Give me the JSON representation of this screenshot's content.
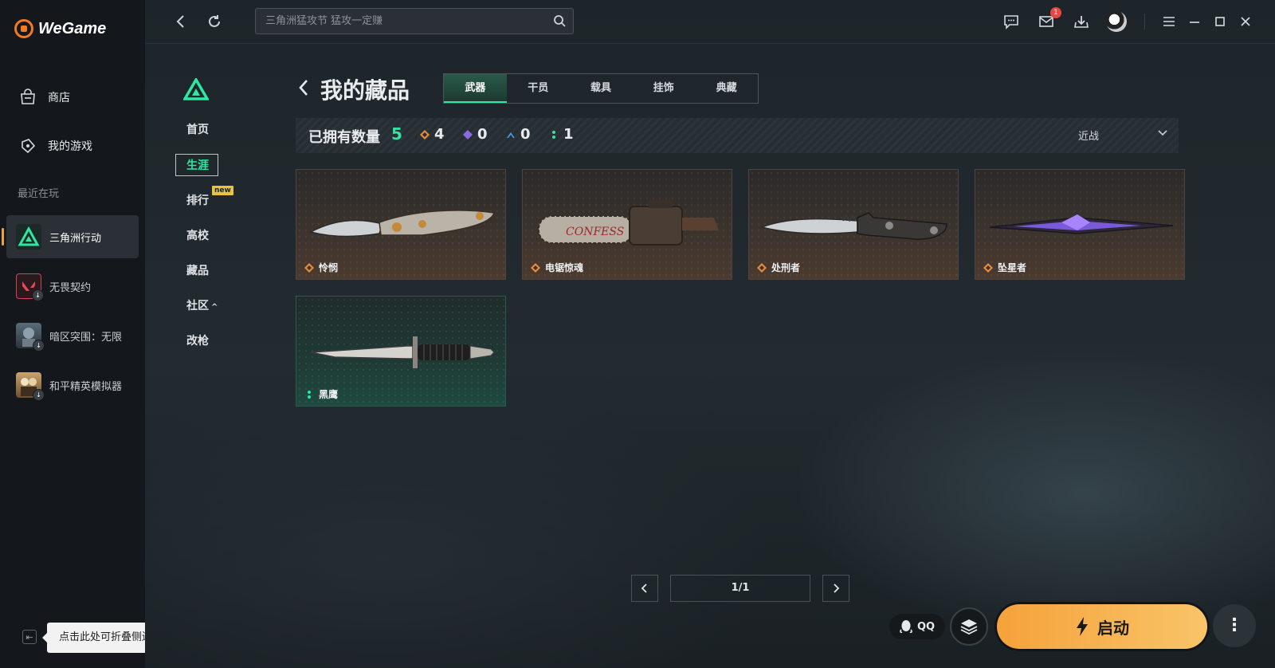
{
  "app": {
    "brand": "WeGame",
    "nav": [
      {
        "label": "商店",
        "icon": "store-icon"
      },
      {
        "label": "我的游戏",
        "icon": "gamepad-icon"
      }
    ],
    "recent_label": "最近在玩",
    "recent_games": [
      {
        "label": "三角洲行动",
        "active": true
      },
      {
        "label": "无畏契约",
        "active": false
      },
      {
        "label": "暗区突围：无限",
        "active": false
      },
      {
        "label": "和平精英模拟器",
        "active": false
      }
    ],
    "collapse_tooltip": "点击此处可折叠侧边栏"
  },
  "topbar": {
    "search_placeholder": "三角洲猛攻节  猛攻一定赚",
    "mail_badge": "1"
  },
  "game_nav": {
    "items": [
      "首页",
      "生涯",
      "排行",
      "高校",
      "藏品",
      "社区",
      "改枪"
    ],
    "active": "生涯",
    "new_badge": "new",
    "community_caret": "^"
  },
  "collection": {
    "title": "我的藏品",
    "tabs": [
      "武器",
      "干员",
      "载具",
      "挂饰",
      "典藏"
    ],
    "active_tab": "武器",
    "owned_label": "已拥有数量",
    "owned_total": "5",
    "rarity_counts": [
      {
        "color": "#e88a3a",
        "count": "4"
      },
      {
        "color": "#8a6ae0",
        "count": "0"
      },
      {
        "color": "#4a9ad8",
        "count": "0"
      },
      {
        "color": "#2ee7a1",
        "count": "1"
      }
    ],
    "sort_label": "近战",
    "items": [
      {
        "name": "怜悯",
        "rarity_color": "#e88a3a"
      },
      {
        "name": "电锯惊魂",
        "rarity_color": "#e88a3a"
      },
      {
        "name": "处刑者",
        "rarity_color": "#e88a3a"
      },
      {
        "name": "坠星者",
        "rarity_color": "#e88a3a"
      },
      {
        "name": "黑鹰",
        "rarity_color": "#2ee7a1"
      }
    ],
    "page": "1/1"
  },
  "launch": {
    "qq_label": "QQ",
    "button_label": "启动",
    "more_label": "⋮"
  },
  "colors": {
    "accent_green": "#2ee7a1",
    "launch_orange": "#f5a23a",
    "brand_orange": "#f47a1f"
  }
}
